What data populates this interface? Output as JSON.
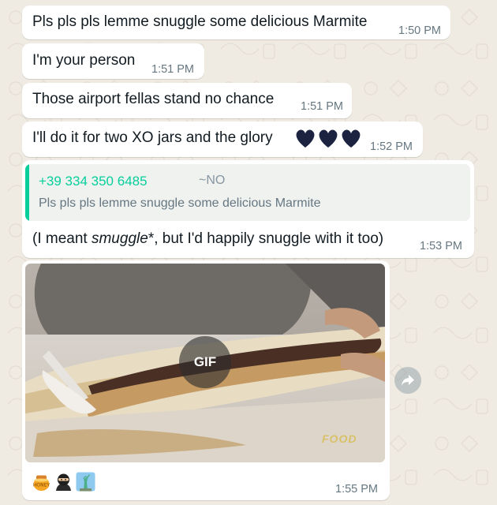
{
  "messages": [
    {
      "text": "Pls pls pls lemme snuggle some delicious Marmite",
      "time": "1:50 PM"
    },
    {
      "text": "I'm your person",
      "time": "1:51 PM"
    },
    {
      "text": "Those airport fellas stand no chance",
      "time": "1:51 PM"
    },
    {
      "text": "I'll do it for two XO jars and the glory",
      "time": "1:52 PM",
      "emoji": "🖤🖤🖤"
    }
  ],
  "reply": {
    "quoted_sender": "+39 334 350 6485",
    "quoted_push_name": "~NO",
    "quoted_text": "Pls pls pls lemme snuggle some delicious Marmite",
    "text_before": "(I meant ",
    "text_italic": "smuggle",
    "text_after": "*, but I'd happily snuggle with it too)",
    "time": "1:53 PM"
  },
  "gif_message": {
    "badge": "GIF",
    "watermark": "FOOD",
    "reactions": [
      "honey-pot-icon",
      "ninja-icon",
      "statue-of-liberty-icon"
    ],
    "time": "1:55 PM"
  },
  "colors": {
    "background": "#efeae2",
    "bubble": "#ffffff",
    "quote_accent": "#06cf9c",
    "timestamp": "#667781",
    "heart": "#1c2340"
  },
  "icons": {
    "forward": "forward-icon"
  }
}
